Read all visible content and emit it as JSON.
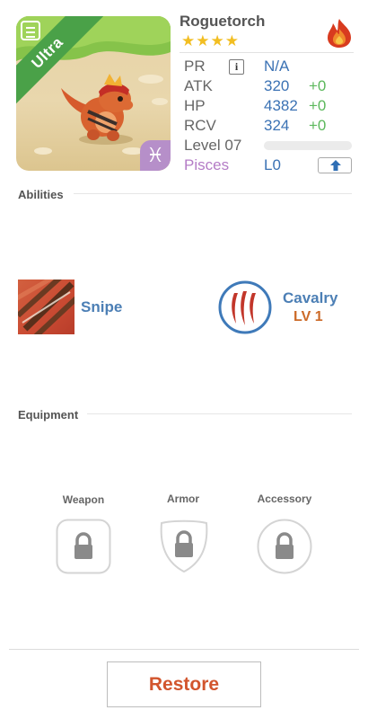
{
  "monster": {
    "rarity": "Ultra",
    "name": "Roguetorch",
    "stars": "★★★★",
    "element_icon": "fire-icon",
    "zodiac_symbol": "♓"
  },
  "stats": {
    "pr": {
      "label": "PR",
      "value": "N/A"
    },
    "atk": {
      "label": "ATK",
      "value": "320",
      "bonus": "+0"
    },
    "hp": {
      "label": "HP",
      "value": "4382",
      "bonus": "+0"
    },
    "rcv": {
      "label": "RCV",
      "value": "324",
      "bonus": "+0"
    },
    "level": {
      "label": "Level 07",
      "progress": 0
    },
    "zodiac": {
      "label": "Pisces",
      "value": "L0"
    }
  },
  "abilities": {
    "title": "Abilities",
    "items": [
      {
        "name": "Snipe",
        "icon": "snipe-icon"
      },
      {
        "name": "Cavalry",
        "level": "LV 1",
        "icon": "claw-slash-icon"
      }
    ]
  },
  "equipment": {
    "title": "Equipment",
    "slots": [
      {
        "label": "Weapon",
        "icon": "lock-icon"
      },
      {
        "label": "Armor",
        "icon": "lock-icon"
      },
      {
        "label": "Accessory",
        "icon": "lock-icon"
      }
    ]
  },
  "footer": {
    "restore_label": "Restore"
  },
  "colors": {
    "accent_blue": "#3b72b4",
    "bonus_green": "#5cb85c",
    "restore_orange": "#d2552d",
    "zodiac_purple": "#b47cc6",
    "rarity_green": "#4aa148"
  }
}
